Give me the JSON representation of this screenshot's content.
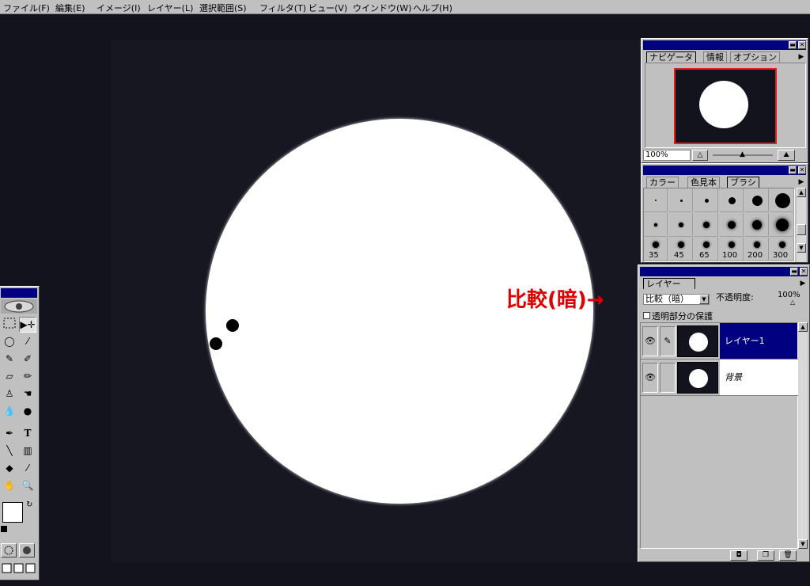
{
  "menu": [
    "ファイル(F)",
    "編集(E)",
    "イメージ(I)",
    "レイヤー(L)",
    "選択範囲(S)",
    "フィルタ(T)",
    "ビュー(V)",
    "ウインドウ(W)",
    "ヘルプ(H)"
  ],
  "navigator": {
    "tabs": [
      "ナビゲータ",
      "情報",
      "オプション"
    ],
    "zoom": "100%"
  },
  "brushes": {
    "tabs": [
      "カラー",
      "色見本",
      "ブラシ"
    ],
    "sizes": [
      "35",
      "45",
      "65",
      "100",
      "200",
      "300"
    ]
  },
  "layers": {
    "tab": "レイヤー",
    "blend_mode": "比較（暗）",
    "opacity_label": "不透明度:",
    "opacity_value": "100%",
    "preserve_label": "透明部分の保護",
    "items": [
      {
        "name": "レイヤー1",
        "selected": true
      },
      {
        "name": "背景",
        "selected": false
      }
    ]
  },
  "annotation": "比較(暗)→",
  "colors": {
    "accent": "#000080",
    "annotation": "#e00000",
    "canvas": "#13131d"
  }
}
